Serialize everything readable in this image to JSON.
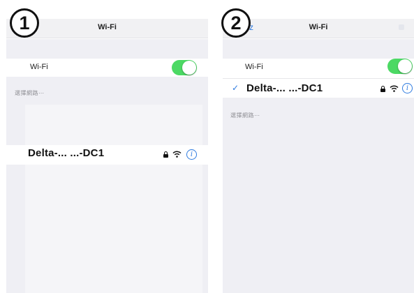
{
  "steps": [
    {
      "badge": "1",
      "nav_title": "Wi-Fi",
      "wifi_label": "Wi-Fi",
      "wifi_on": true,
      "section_label": "選擇網路⋯",
      "network_name": "Delta-... ...-DC1",
      "network_secured": true
    },
    {
      "badge": "2",
      "nav_back": "z",
      "nav_title": "Wi-Fi",
      "wifi_label": "Wi-Fi",
      "wifi_on": true,
      "connected_network_name": "Delta-... ...-DC1",
      "connected": true,
      "section_label": "選擇網路⋯"
    }
  ],
  "icons": {
    "lock": "lock-icon",
    "wifi": "wifi-icon",
    "info": "info-icon",
    "check": "check-icon"
  },
  "colors": {
    "toggle_on": "#4cd964",
    "accent": "#2f7be0",
    "background_grey": "#efeff4"
  }
}
